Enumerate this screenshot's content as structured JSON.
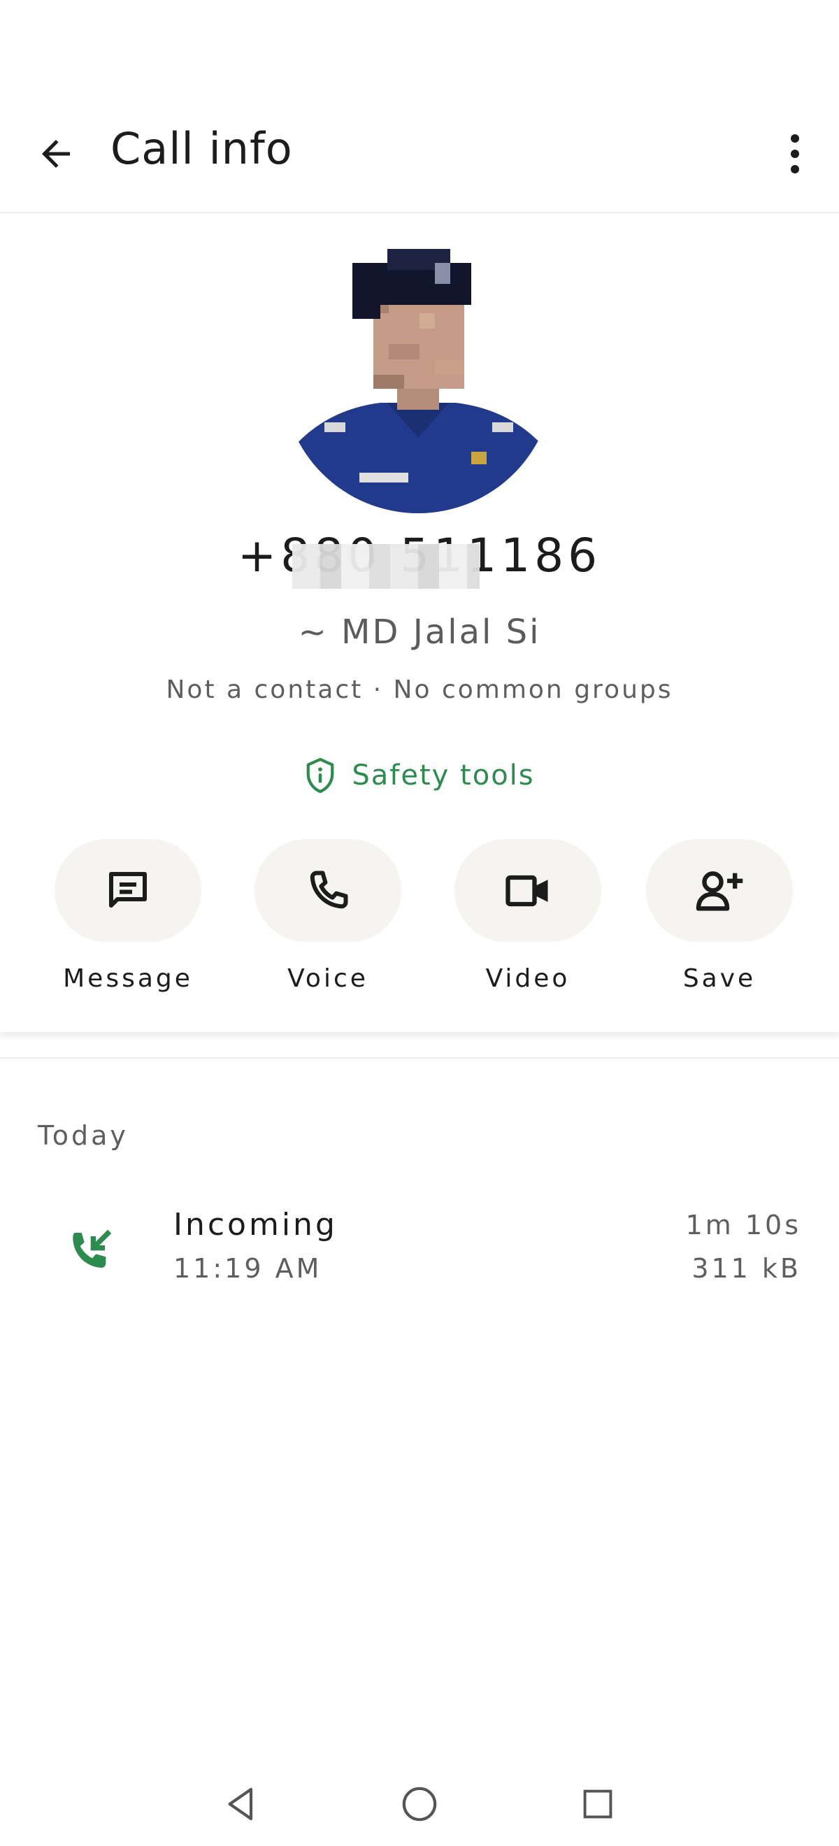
{
  "header": {
    "title": "Call info",
    "back_icon": "arrow-back-icon",
    "menu_icon": "more-vert-icon"
  },
  "profile": {
    "phone": "+880 511186",
    "name": "~ MD Jalal Si",
    "subline": "Not a contact · No common groups",
    "safety_tools_label": "Safety tools",
    "accent_color": "#2e8b4f"
  },
  "actions": [
    {
      "label": "Message",
      "icon": "message-icon"
    },
    {
      "label": "Voice",
      "icon": "phone-icon"
    },
    {
      "label": "Video",
      "icon": "video-icon"
    },
    {
      "label": "Save",
      "icon": "add-person-icon"
    }
  ],
  "history": {
    "section_label": "Today",
    "calls": [
      {
        "type": "Incoming",
        "time": "11:19 AM",
        "duration": "1m 10s",
        "size": "311 kB",
        "icon": "incoming-call-icon"
      }
    ]
  },
  "navbar": {
    "back_icon": "nav-back-icon",
    "home_icon": "nav-home-icon",
    "recents_icon": "nav-recents-icon"
  }
}
